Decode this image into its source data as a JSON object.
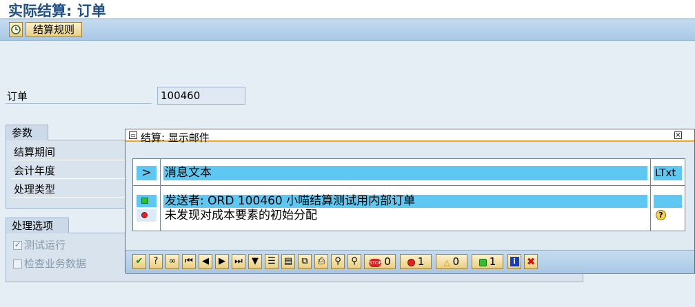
{
  "window": {
    "title": "实际结算: 订单"
  },
  "toolbar": {
    "execute_icon": "clock-execute-icon",
    "rules_label": "结算规则"
  },
  "order": {
    "label": "订单",
    "value": "100460"
  },
  "parameters": {
    "tab_label": "参数",
    "fields": [
      {
        "label": "结算期间"
      },
      {
        "label": "会计年度"
      },
      {
        "label": "处理类型"
      }
    ]
  },
  "processing": {
    "tab_label": "处理选项",
    "options": [
      {
        "label": "测试运行",
        "checked": true
      },
      {
        "label": "检查业务数据",
        "checked": false
      }
    ]
  },
  "popup": {
    "title": "结算: 显示邮件",
    "header_arrow": ">",
    "column_header": "消息文本",
    "longtext_header": "LTxt",
    "messages": [
      {
        "status": "green",
        "text": "发送者: ORD 100460 小喵结算测试用内部订单",
        "has_longtext": false
      },
      {
        "status": "red",
        "text": "未发现对成本要素的初始分配",
        "has_longtext": true
      }
    ],
    "counts": {
      "stop": "0",
      "error": "1",
      "warning": "0",
      "success": "1"
    }
  },
  "colors": {
    "accent": "#f0a81c",
    "title": "#1f4f86",
    "highlight": "#5ec8f2"
  }
}
